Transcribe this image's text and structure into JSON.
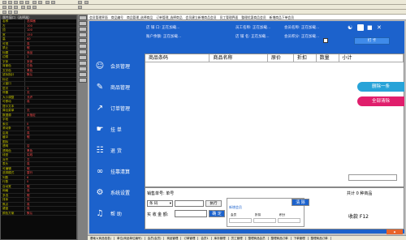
{
  "menu": [
    "会员管理界面",
    "商品编号",
    "商品管理_选择商品",
    "订单管理_选择商品",
    "会员建立新增商品会员",
    "员工管理界面",
    "整理优惠商品会员",
    "新增商品下单会员"
  ],
  "palette": {
    "title": "属性窗口（选择器）",
    "rows": [
      {
        "k": "名称",
        "v": "选择器"
      },
      {
        "k": "左",
        "v": "100"
      },
      {
        "k": "顶",
        "v": "100"
      },
      {
        "k": "宽",
        "v": "150"
      },
      {
        "k": "高",
        "v": "80"
      },
      {
        "k": "可视",
        "v": "真"
      },
      {
        "k": "禁止",
        "v": "假"
      },
      {
        "k": "标题",
        "v": "商品"
      },
      {
        "k": "边框",
        "v": "1"
      },
      {
        "k": "字体",
        "v": "宋体"
      },
      {
        "k": "背景色",
        "v": "白色"
      },
      {
        "k": "文字色",
        "v": "黑色"
      },
      {
        "k": "鼠标指针",
        "v": "默认"
      },
      {
        "k": "标记",
        "v": ""
      },
      {
        "k": "父窗口",
        "v": ""
      },
      {
        "k": "层次",
        "v": "1"
      },
      {
        "k": "停靠",
        "v": "无"
      },
      {
        "k": "大小调整",
        "v": "允许"
      },
      {
        "k": "可移动",
        "v": "真"
      },
      {
        "k": "提示文本",
        "v": ""
      },
      {
        "k": "弹出菜单",
        "v": "无"
      },
      {
        "k": "数据源",
        "v": "未指定"
      },
      {
        "k": "字段",
        "v": ""
      },
      {
        "k": "索引",
        "v": "0"
      },
      {
        "k": "滚动条",
        "v": "无"
      },
      {
        "k": "启用",
        "v": "真"
      },
      {
        "k": "缓冲",
        "v": "假"
      },
      {
        "k": "图标",
        "v": ""
      },
      {
        "k": "透明",
        "v": "否"
      },
      {
        "k": "透明色",
        "v": "黑色"
      },
      {
        "k": "线型",
        "v": "实线"
      },
      {
        "k": "对齐",
        "v": "左"
      },
      {
        "k": "表头",
        "v": "真"
      },
      {
        "k": "可编辑",
        "v": "假"
      },
      {
        "k": "选择模式",
        "v": "整行"
      },
      {
        "k": "列数",
        "v": "6"
      },
      {
        "k": "行数",
        "v": "0"
      },
      {
        "k": "自动宽",
        "v": "假"
      },
      {
        "k": "网格",
        "v": "真"
      },
      {
        "k": "多选",
        "v": "假"
      },
      {
        "k": "排序",
        "v": "无"
      },
      {
        "k": "焦点",
        "v": "真"
      },
      {
        "k": "键盘",
        "v": "真"
      },
      {
        "k": "颜色方案",
        "v": "默认"
      }
    ]
  },
  "form": {
    "sidebar": [
      {
        "icon": "user-icon",
        "label": "会员管理"
      },
      {
        "icon": "edit-icon",
        "label": "商品管理"
      },
      {
        "icon": "chart-icon",
        "label": "订单管理"
      },
      {
        "icon": "handoff-icon",
        "label": "挂    单"
      },
      {
        "icon": "cart-icon",
        "label": "退    货"
      },
      {
        "icon": "link-icon",
        "label": "挂靠清算"
      },
      {
        "icon": "gear-icon",
        "label": "系统设置"
      },
      {
        "icon": "bell-icon",
        "label": "帮    助"
      }
    ],
    "info1": "店 铺 口:    正在加载...",
    "info2": "账户余额:    正在加载...",
    "info3": "员工名称:    正在加载...",
    "info4": "店 铺 名:    正在加载...",
    "info5": "会员名称:    正在加载...",
    "info6": "会员积分:    正在加载...",
    "top_btn": "打 卡",
    "columns": [
      "商品条码",
      "商品名称",
      "原价",
      "折扣",
      "数量",
      "小计"
    ],
    "btn_delete_one": "删除一条",
    "btn_clear_all": "全部清除",
    "sale_no": "销售单号:    单号",
    "total": "共计 0 种商品",
    "combo_value": "条 码",
    "btn_execute": "执行",
    "amount_label": "实 收 金 额:",
    "btn_confirm": "确 定",
    "points_label": "新增会员",
    "pts_a": "会员",
    "pts_b": "折扣",
    "pts_c": "积分",
    "btn_clear": "清 除",
    "checkout": "收款 F12",
    "status": [
      "基础1(商品信息)",
      "单位(商品单位编号)",
      "会员(会员)",
      "商品管理",
      "订单管理",
      "会员1",
      "库存管理",
      "员工管理",
      "整理商品会员",
      "整理商品订单",
      "下单管理",
      "整理商品订单"
    ]
  }
}
